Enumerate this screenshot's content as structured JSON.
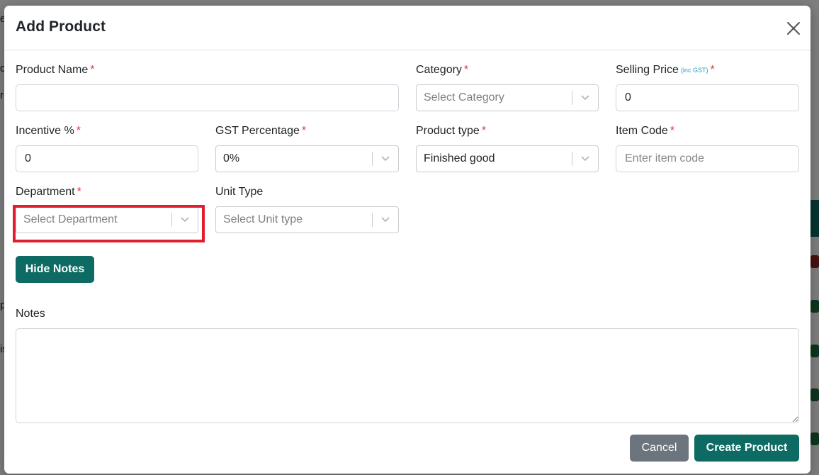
{
  "background": {
    "fragments": [
      "e",
      "c",
      "ro",
      "p",
      "is"
    ]
  },
  "modal": {
    "title": "Add Product",
    "close_icon": "close-icon",
    "fields": {
      "product_name": {
        "label": "Product Name",
        "required_mark": "*",
        "value": "",
        "placeholder": ""
      },
      "category": {
        "label": "Category",
        "required_mark": "*",
        "placeholder": "Select Category"
      },
      "selling_price": {
        "label": "Selling Price",
        "hint": "(inc GST)",
        "required_mark": "*",
        "value": "0"
      },
      "incentive": {
        "label": "Incentive %",
        "required_mark": "*",
        "value": "0"
      },
      "gst_percentage": {
        "label": "GST Percentage",
        "required_mark": "*",
        "value": "0%"
      },
      "product_type": {
        "label": "Product type",
        "required_mark": "*",
        "value": "Finished good"
      },
      "item_code": {
        "label": "Item Code",
        "required_mark": "*",
        "value": "",
        "placeholder": "Enter item code"
      },
      "department": {
        "label": "Department",
        "required_mark": "*",
        "placeholder": "Select Department"
      },
      "unit_type": {
        "label": "Unit Type",
        "placeholder": "Select Unit type"
      }
    },
    "hide_notes_label": "Hide Notes",
    "notes": {
      "label": "Notes",
      "value": ""
    },
    "footer": {
      "cancel_label": "Cancel",
      "create_label": "Create Product"
    }
  },
  "colors": {
    "primary": "#0d6b63",
    "secondary": "#6c757d",
    "required": "#dc3545",
    "hint": "#17a2b8",
    "highlight": "#e01e2d"
  }
}
